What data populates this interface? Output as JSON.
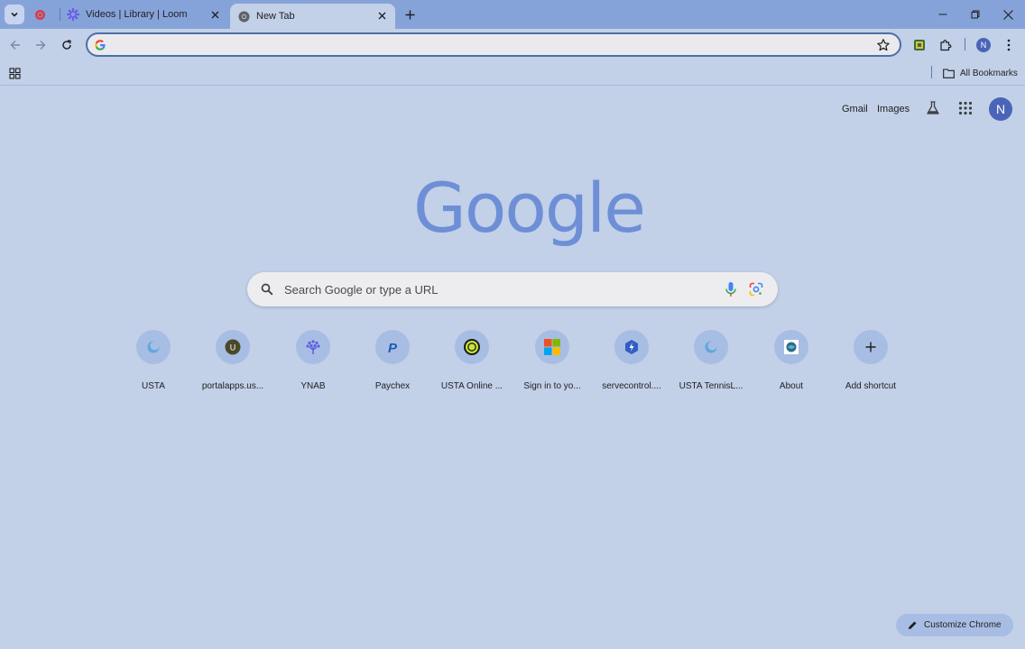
{
  "tabs": [
    {
      "title": "",
      "favicon": "recording-icon",
      "pinned": true
    },
    {
      "title": "Videos | Library | Loom",
      "favicon": "loom-icon"
    },
    {
      "title": "New Tab",
      "favicon": "chrome-icon",
      "active": true
    }
  ],
  "omnibox": {
    "value": "",
    "placeholder": ""
  },
  "bookmarks": {
    "all_bookmarks_label": "All Bookmarks"
  },
  "ntp": {
    "gmail_label": "Gmail",
    "images_label": "Images",
    "avatar_initial": "N",
    "logo_text": "Google",
    "search_placeholder": "Search Google or type a URL",
    "customize_label": "Customize Chrome"
  },
  "profile": {
    "initial": "N"
  },
  "shortcuts": [
    {
      "label": "USTA",
      "icon": "usta-icon"
    },
    {
      "label": "portalapps.us...",
      "icon": "portalapps-icon"
    },
    {
      "label": "YNAB",
      "icon": "ynab-icon"
    },
    {
      "label": "Paychex",
      "icon": "paychex-icon"
    },
    {
      "label": "USTA Online ...",
      "icon": "tennis-ball-icon"
    },
    {
      "label": "Sign in to yo...",
      "icon": "microsoft-icon"
    },
    {
      "label": "servecontrol....",
      "icon": "servecontrol-icon"
    },
    {
      "label": "USTA TennisL...",
      "icon": "usta-tennislink-icon"
    },
    {
      "label": "About",
      "icon": "about-icon"
    },
    {
      "label": "Add shortcut",
      "icon": "plus-icon"
    }
  ],
  "colors": {
    "background": "#c2d0e8",
    "tabstrip": "#86a3d9",
    "accent": "#4a64b8",
    "logo": "#6e8fd6"
  }
}
